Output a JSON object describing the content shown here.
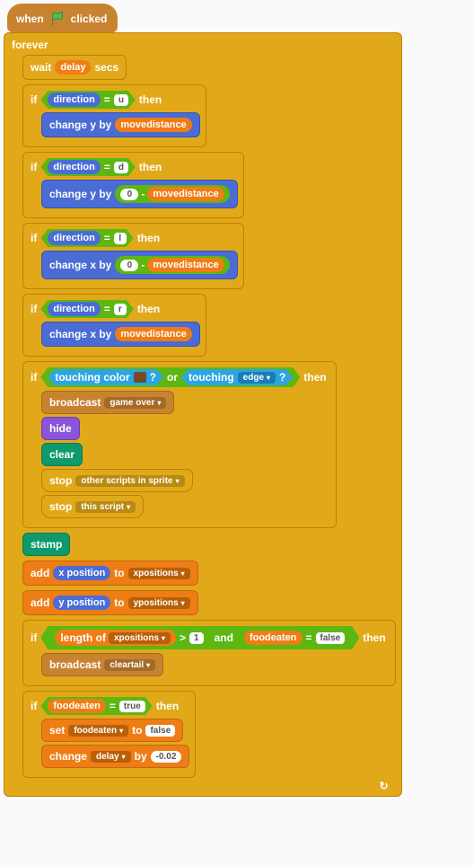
{
  "hat": {
    "when": "when",
    "clicked": "clicked"
  },
  "forever": "forever",
  "wait": {
    "label1": "wait",
    "var": "delay",
    "label2": "secs"
  },
  "if": "if",
  "then": "then",
  "direction": "direction",
  "eq": "=",
  "dirs": {
    "u": "u",
    "d": "d",
    "l": "l",
    "r": "r"
  },
  "change_y_by": "change y by",
  "change_x_by": "change x by",
  "movedistance": "movedistance",
  "zero": "0",
  "minus": "-",
  "touching_color": "touching color",
  "qmark": "?",
  "or": "or",
  "touching": "touching",
  "edge": "edge",
  "broadcast": "broadcast",
  "gameover": "game over",
  "hide": "hide",
  "clear": "clear",
  "stop": "stop",
  "other_scripts": "other scripts in sprite",
  "this_script": "this script",
  "stamp": "stamp",
  "add": "add",
  "to": "to",
  "xposition": "x position",
  "yposition": "y position",
  "xpositions": "xpositions",
  "ypositions": "ypositions",
  "length_of": "length of",
  "gt": ">",
  "one": "1",
  "and": "and",
  "foodeaten": "foodeaten",
  "false": "false",
  "true": "true",
  "cleartail": "cleartail",
  "set": "set",
  "change": "change",
  "by": "by",
  "delay": "delay",
  "delta": "-0.02"
}
